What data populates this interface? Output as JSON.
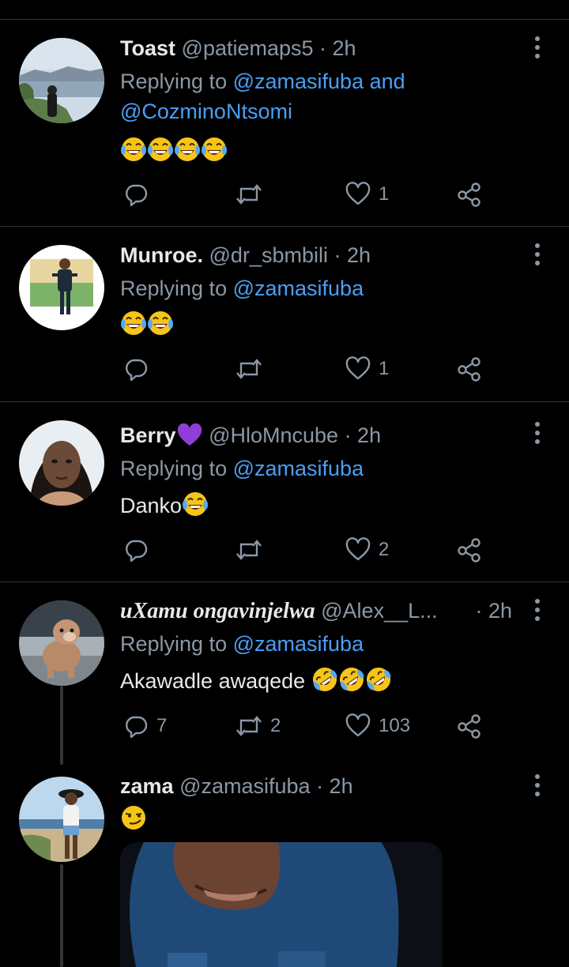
{
  "tweets": [
    {
      "name": "Toast",
      "handle": "@patiemaps5",
      "time": "· 2h",
      "replying_prefix": "Replying to",
      "mentions": [
        "@zamasifuba",
        "@CozminoNtsomi"
      ],
      "mention_joiner": "and",
      "text": "",
      "emojis": [
        "face-with-tears-of-joy",
        "face-with-tears-of-joy",
        "face-with-tears-of-joy",
        "face-with-tears-of-joy"
      ],
      "reply_count": "",
      "retweet_count": "",
      "like_count": "1"
    },
    {
      "name": "Munroe.",
      "handle": "@dr_sbmbili",
      "time": "· 2h",
      "replying_prefix": "Replying to",
      "mentions": [
        "@zamasifuba"
      ],
      "text": "",
      "emojis": [
        "face-with-tears-of-joy",
        "face-with-tears-of-joy"
      ],
      "reply_count": "",
      "retweet_count": "",
      "like_count": "1"
    },
    {
      "name": "Berry",
      "name_emoji": "purple-heart",
      "handle": "@HloMncube",
      "time": "· 2h",
      "replying_prefix": "Replying to",
      "mentions": [
        "@zamasifuba"
      ],
      "text": "Danko",
      "emojis": [
        "face-with-tears-of-joy"
      ],
      "reply_count": "",
      "retweet_count": "",
      "like_count": "2"
    },
    {
      "name": "uXamu ongavinjelwa",
      "handle": "@Alex__L...",
      "time": "· 2h",
      "replying_prefix": "Replying to",
      "mentions": [
        "@zamasifuba"
      ],
      "text": "Akawadle awaqede",
      "emojis": [
        "rolling-on-floor-laughing",
        "rolling-on-floor-laughing",
        "rolling-on-floor-laughing"
      ],
      "reply_count": "7",
      "retweet_count": "2",
      "like_count": "103"
    },
    {
      "name": "zama",
      "handle": "@zamasifuba",
      "time": "· 2h",
      "emojis": [
        "smirking-face"
      ]
    }
  ],
  "colors": {
    "background": "#000000",
    "text": "#e7e9ea",
    "muted": "#8b98a5",
    "link": "#4a9ff5",
    "divider": "#2f3336"
  }
}
